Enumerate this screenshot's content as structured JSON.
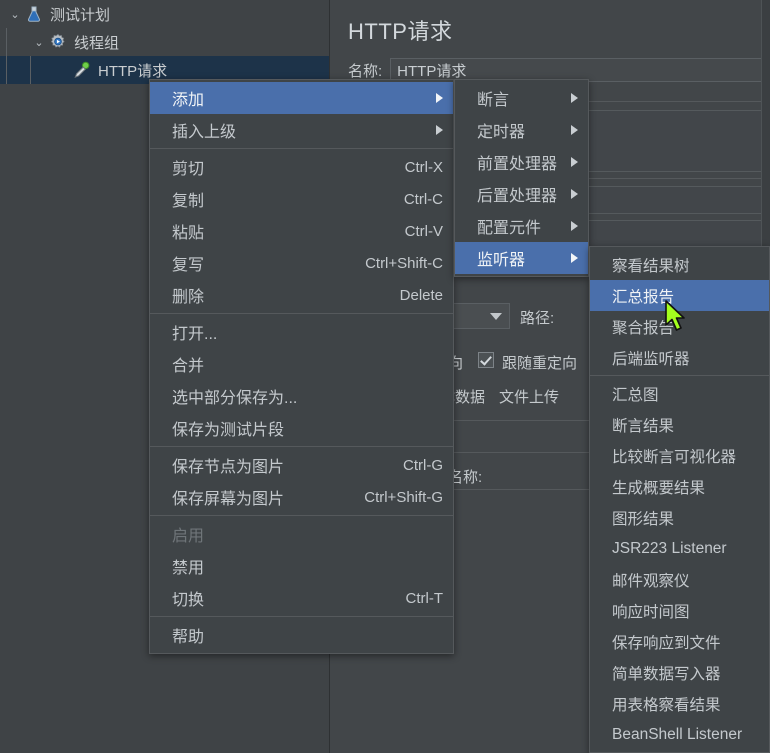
{
  "app": {
    "accent_highlight": "#4a6fab",
    "menu_bg": "#3f4447",
    "panel_bg": "#424649",
    "tree_selected_bg": "#1d3349",
    "text_color": "#c4c9cd",
    "cursor_color": "#a4ff1e"
  },
  "tree": {
    "items": [
      {
        "label": "测试计划",
        "icon": "flask-icon",
        "twisty": "⌄",
        "depth": 0,
        "selected": false
      },
      {
        "label": "线程组",
        "icon": "gear-icon",
        "twisty": "⌄",
        "depth": 1,
        "selected": false
      },
      {
        "label": "HTTP请求",
        "icon": "dropper-icon",
        "twisty": "",
        "depth": 2,
        "selected": true
      }
    ]
  },
  "detail": {
    "title": "HTTP请求",
    "name_label": "名称:",
    "name_value": "HTTP请求",
    "path_label": "路径:",
    "redirect_label_partial": "向",
    "follow_redirect_label": "跟随重定向",
    "tab_body_data": "体数据",
    "tab_file_upload": "文件上传",
    "second_name_label": "名称:"
  },
  "context_menu": {
    "items": [
      {
        "label": "添加",
        "accel": "",
        "submenu": true,
        "selected": true,
        "disabled": false
      },
      {
        "label": "插入上级",
        "accel": "",
        "submenu": true,
        "selected": false,
        "disabled": false
      },
      {
        "separator": true
      },
      {
        "label": "剪切",
        "accel": "Ctrl-X",
        "submenu": false,
        "selected": false,
        "disabled": false
      },
      {
        "label": "复制",
        "accel": "Ctrl-C",
        "submenu": false,
        "selected": false,
        "disabled": false
      },
      {
        "label": "粘贴",
        "accel": "Ctrl-V",
        "submenu": false,
        "selected": false,
        "disabled": false
      },
      {
        "label": "复写",
        "accel": "Ctrl+Shift-C",
        "submenu": false,
        "selected": false,
        "disabled": false
      },
      {
        "label": "删除",
        "accel": "Delete",
        "submenu": false,
        "selected": false,
        "disabled": false
      },
      {
        "separator": true
      },
      {
        "label": "打开...",
        "accel": "",
        "submenu": false,
        "selected": false,
        "disabled": false
      },
      {
        "label": "合并",
        "accel": "",
        "submenu": false,
        "selected": false,
        "disabled": false
      },
      {
        "label": "选中部分保存为...",
        "accel": "",
        "submenu": false,
        "selected": false,
        "disabled": false
      },
      {
        "label": "保存为测试片段",
        "accel": "",
        "submenu": false,
        "selected": false,
        "disabled": false
      },
      {
        "separator": true
      },
      {
        "label": "保存节点为图片",
        "accel": "Ctrl-G",
        "submenu": false,
        "selected": false,
        "disabled": false
      },
      {
        "label": "保存屏幕为图片",
        "accel": "Ctrl+Shift-G",
        "submenu": false,
        "selected": false,
        "disabled": false
      },
      {
        "separator": true
      },
      {
        "label": "启用",
        "accel": "",
        "submenu": false,
        "selected": false,
        "disabled": true
      },
      {
        "label": "禁用",
        "accel": "",
        "submenu": false,
        "selected": false,
        "disabled": false
      },
      {
        "label": "切换",
        "accel": "Ctrl-T",
        "submenu": false,
        "selected": false,
        "disabled": false
      },
      {
        "separator": true
      },
      {
        "label": "帮助",
        "accel": "",
        "submenu": false,
        "selected": false,
        "disabled": false
      }
    ]
  },
  "add_submenu": {
    "items": [
      {
        "label": "断言",
        "submenu": true,
        "selected": false
      },
      {
        "label": "定时器",
        "submenu": true,
        "selected": false
      },
      {
        "label": "前置处理器",
        "submenu": true,
        "selected": false
      },
      {
        "label": "后置处理器",
        "submenu": true,
        "selected": false
      },
      {
        "label": "配置元件",
        "submenu": true,
        "selected": false
      },
      {
        "label": "监听器",
        "submenu": true,
        "selected": true
      }
    ]
  },
  "listener_submenu": {
    "items": [
      {
        "label": "察看结果树",
        "selected": false
      },
      {
        "label": "汇总报告",
        "selected": true
      },
      {
        "label": "聚合报告",
        "selected": false
      },
      {
        "label": "后端监听器",
        "selected": false
      },
      {
        "separator": true
      },
      {
        "label": "汇总图",
        "selected": false
      },
      {
        "label": "断言结果",
        "selected": false
      },
      {
        "label": "比较断言可视化器",
        "selected": false
      },
      {
        "label": "生成概要结果",
        "selected": false
      },
      {
        "label": "图形结果",
        "selected": false
      },
      {
        "label": "JSR223 Listener",
        "selected": false
      },
      {
        "label": "邮件观察仪",
        "selected": false
      },
      {
        "label": "响应时间图",
        "selected": false
      },
      {
        "label": "保存响应到文件",
        "selected": false
      },
      {
        "label": "简单数据写入器",
        "selected": false
      },
      {
        "label": "用表格察看结果",
        "selected": false
      },
      {
        "label": "BeanShell Listener",
        "selected": false
      }
    ]
  }
}
